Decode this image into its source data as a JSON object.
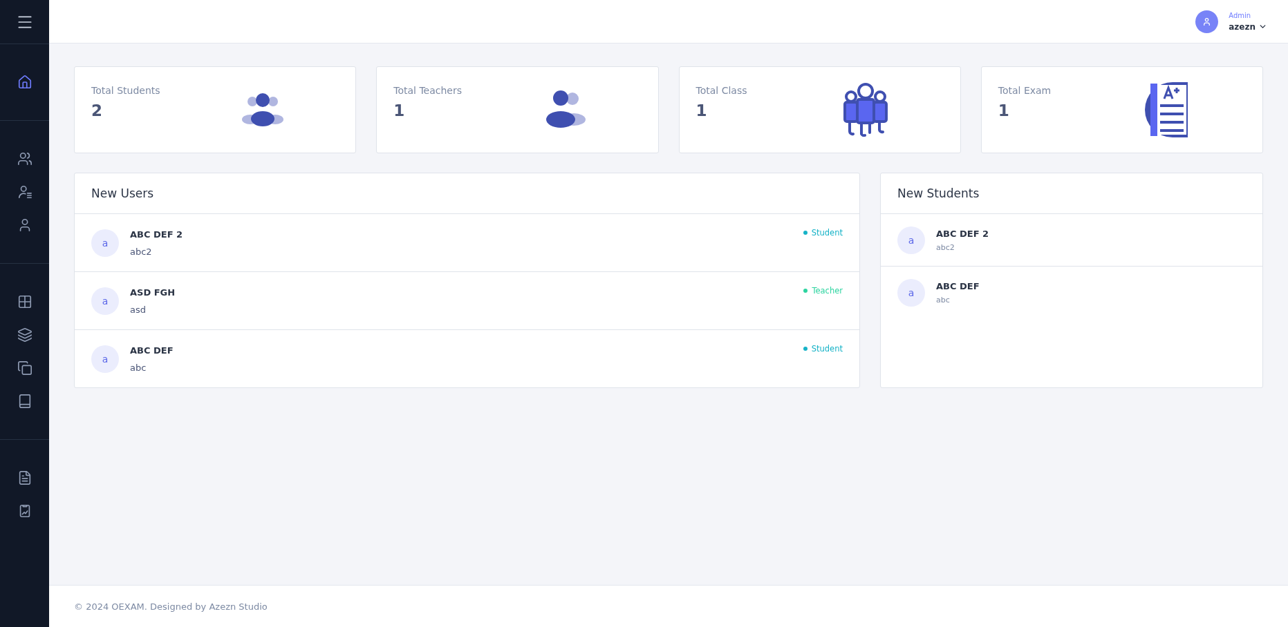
{
  "sidebar": {
    "groups": [
      {
        "items": [
          {
            "kind": "home",
            "selected": true
          }
        ]
      },
      {
        "items": [
          {
            "kind": "users",
            "selected": false
          },
          {
            "kind": "user-list",
            "selected": false
          },
          {
            "kind": "user",
            "selected": false
          }
        ]
      },
      {
        "items": [
          {
            "kind": "grid",
            "selected": false
          },
          {
            "kind": "layers",
            "selected": false
          },
          {
            "kind": "copy",
            "selected": false
          },
          {
            "kind": "book",
            "selected": false
          }
        ]
      },
      {
        "items": [
          {
            "kind": "file",
            "selected": false
          },
          {
            "kind": "report",
            "selected": false
          }
        ]
      }
    ]
  },
  "header": {
    "role": "Admin",
    "username": "azezn"
  },
  "stats": [
    {
      "kind": "students",
      "label": "Total Students",
      "value": "2"
    },
    {
      "kind": "teachers",
      "label": "Total Teachers",
      "value": "1"
    },
    {
      "kind": "class",
      "label": "Total Class",
      "value": "1"
    },
    {
      "kind": "exam",
      "label": "Total Exam",
      "value": "1"
    }
  ],
  "new_users": {
    "title": "New Users",
    "rows": [
      {
        "avatar": "a",
        "name": "ABC DEF 2",
        "username": "abc2",
        "role": "Student",
        "color": "#17b3c7"
      },
      {
        "avatar": "a",
        "name": "ASD FGH",
        "username": "asd",
        "role": "Teacher",
        "color": "#2dd4a0"
      },
      {
        "avatar": "a",
        "name": "ABC DEF",
        "username": "abc",
        "role": "Student",
        "color": "#17b3c7"
      }
    ]
  },
  "new_students": {
    "title": "New Students",
    "rows": [
      {
        "avatar": "a",
        "name": "ABC DEF 2",
        "username": "abc2"
      },
      {
        "avatar": "a",
        "name": "ABC DEF",
        "username": "abc"
      }
    ]
  },
  "footer": "© 2024 OEXAM. Designed by Azezn Studio"
}
